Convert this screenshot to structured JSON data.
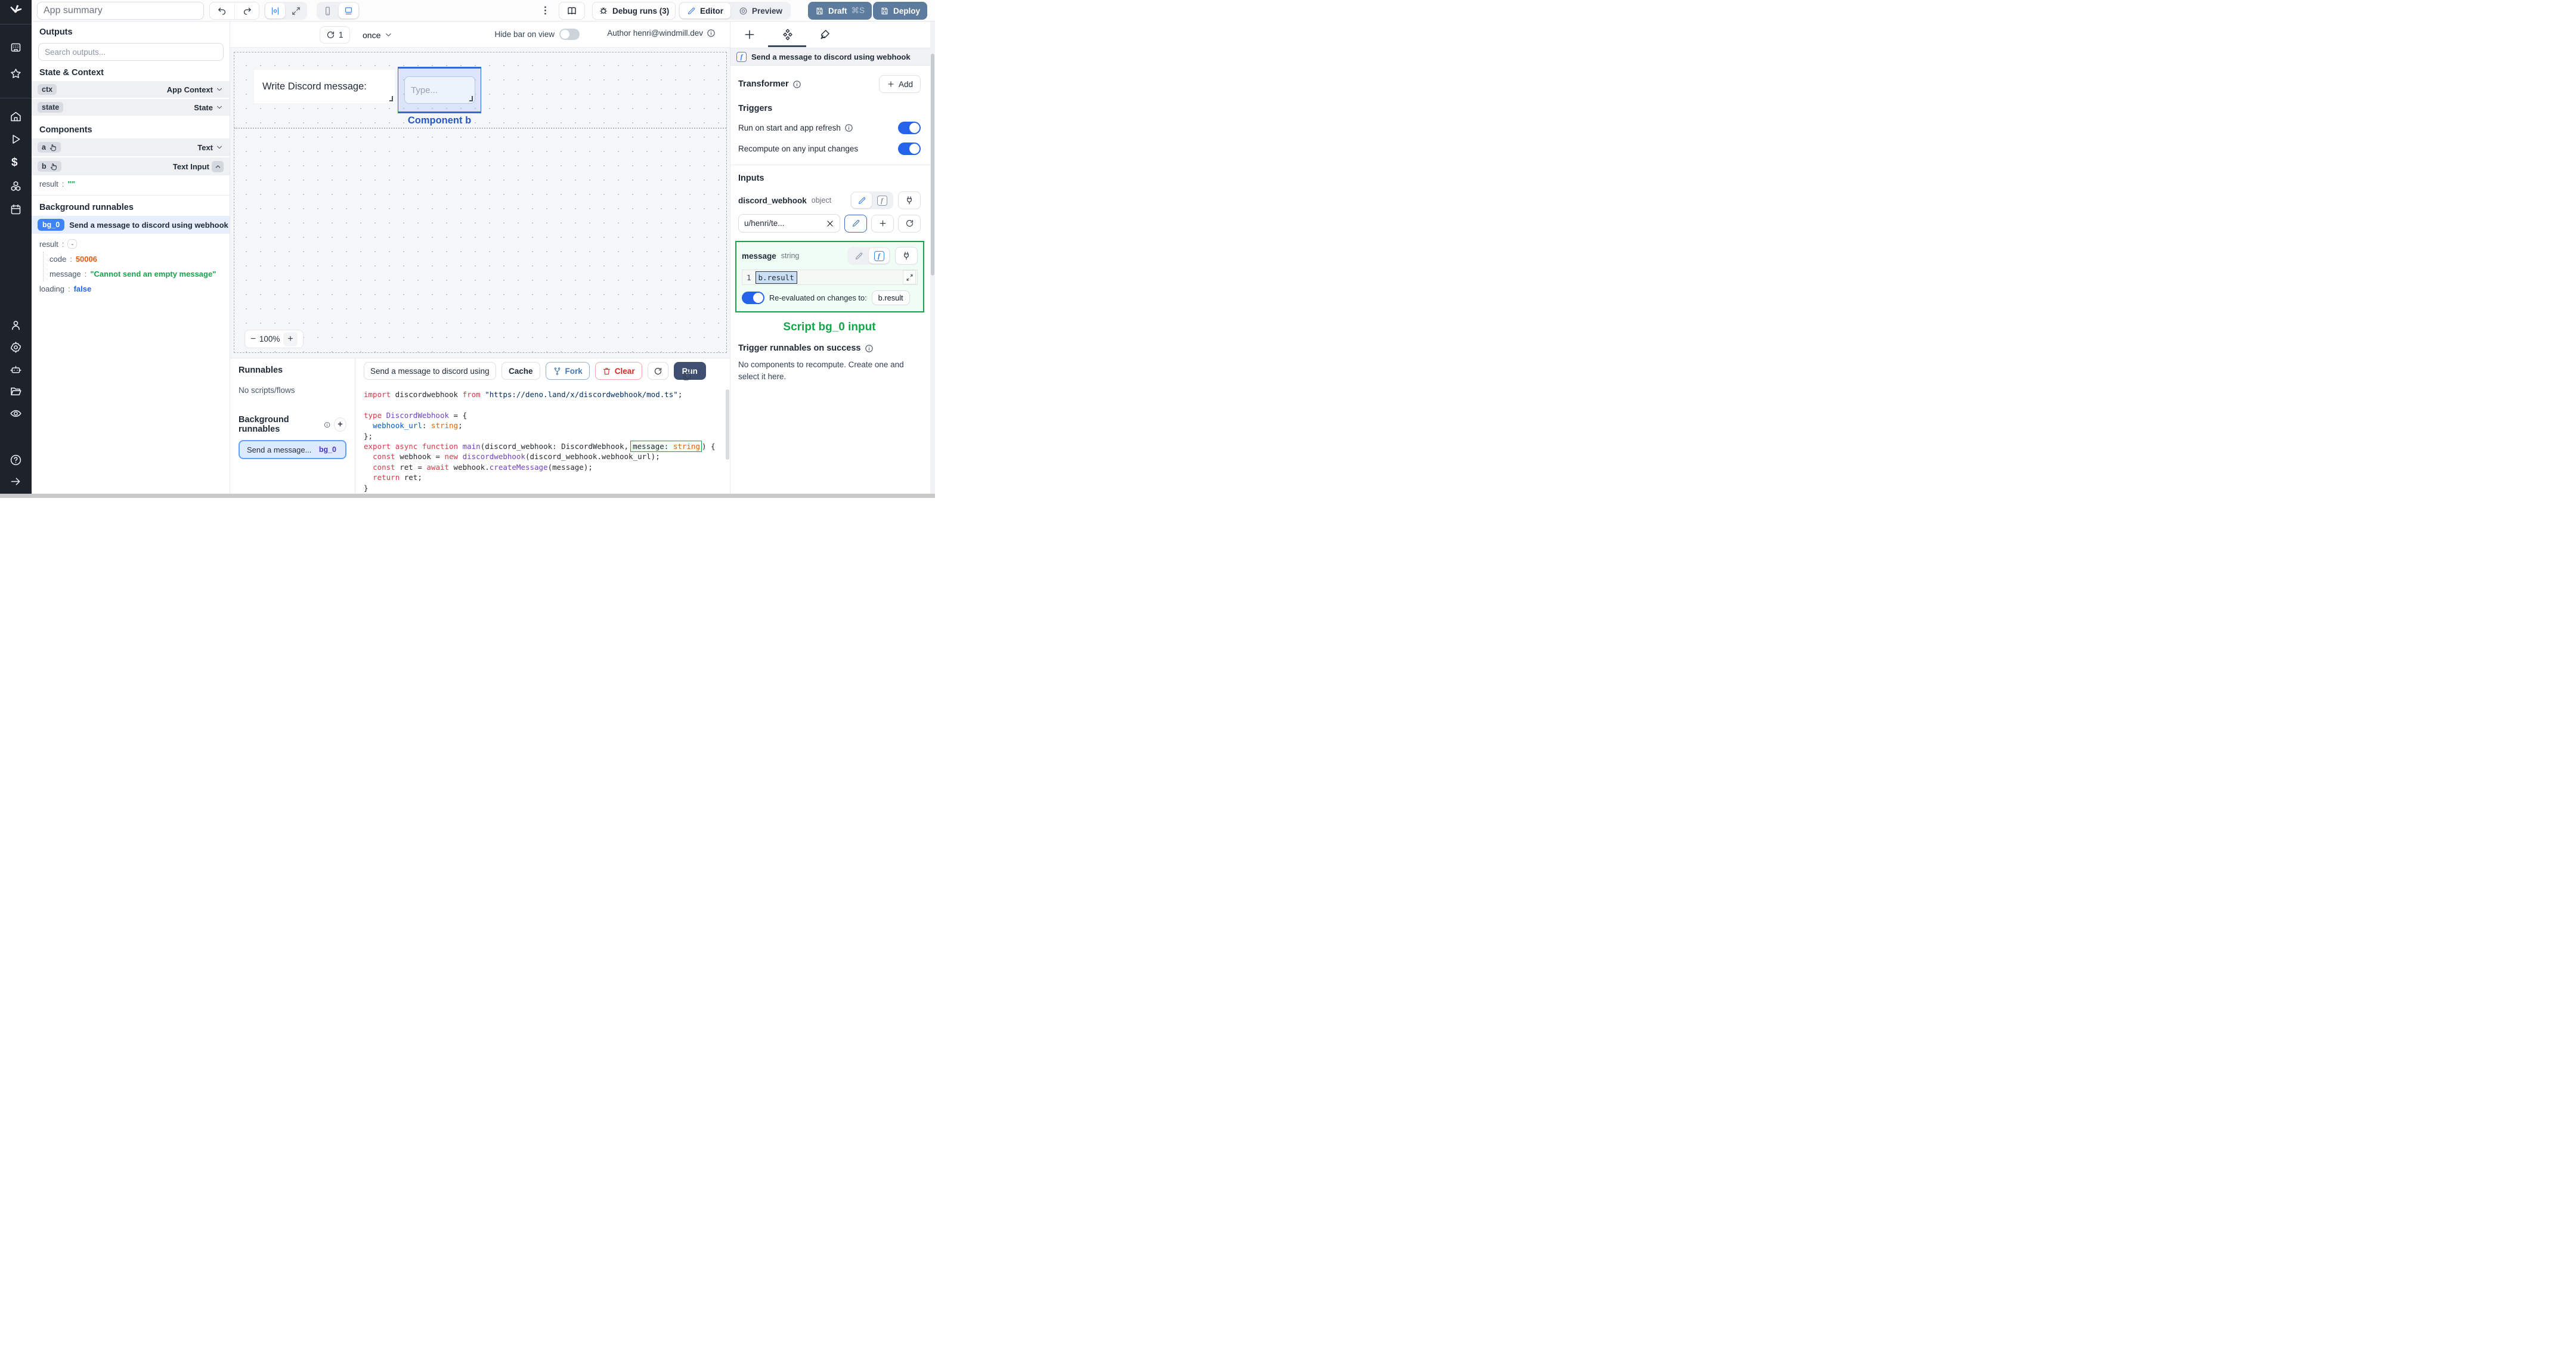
{
  "topbar": {
    "app_summary_placeholder": "App summary",
    "debug_runs_label": "Debug runs (3)",
    "editor_label": "Editor",
    "preview_label": "Preview",
    "draft_label": "Draft",
    "draft_shortcut": "⌘S",
    "deploy_label": "Deploy"
  },
  "left_panel": {
    "outputs_title": "Outputs",
    "search_placeholder": "Search outputs...",
    "state_context_title": "State & Context",
    "ctx": {
      "key": "ctx",
      "type": "App Context"
    },
    "state": {
      "key": "state",
      "type": "State"
    },
    "components_title": "Components",
    "comp_a": {
      "key": "a",
      "type": "Text"
    },
    "comp_b": {
      "key": "b",
      "type": "Text Input",
      "result_key": "result",
      "result_value": "\"\""
    },
    "bg_title": "Background runnables",
    "bg": {
      "badge": "bg_0",
      "name": "Send a message to discord using webhook",
      "result_key": "result",
      "collapse_glyph": "-",
      "code_key": "code",
      "code_value": "50006",
      "message_key": "message",
      "message_value": "\"Cannot send an empty message\"",
      "loading_key": "loading",
      "loading_value": "false"
    }
  },
  "canvas": {
    "refresh_count": "1",
    "mode": "once",
    "hide_bar_label": "Hide bar on view",
    "author_label": "Author henri@windmill.dev",
    "text_component": "Write Discord message:",
    "input_placeholder": "Type...",
    "selected_component_label": "Component b",
    "zoom_minus": "−",
    "zoom_value": "100%",
    "zoom_plus": "+"
  },
  "runnables": {
    "title": "Runnables",
    "empty_text": "No scripts/flows",
    "bg_title": "Background runnables",
    "add_glyph": "+",
    "item_name": "Send a message...",
    "item_badge": "bg_0"
  },
  "editor": {
    "name_value": "Send a message to discord using",
    "cache_label": "Cache",
    "fork_label": "Fork",
    "clear_label": "Clear",
    "run_label": "Run",
    "code_lines": [
      [
        [
          "kw",
          "import"
        ],
        [
          "pl",
          " discordwebhook "
        ],
        [
          "kw",
          "from"
        ],
        [
          "pl",
          " "
        ],
        [
          "str",
          "\"https://deno.land/x/discordwebhook/mod.ts\""
        ],
        [
          "pl",
          ";"
        ]
      ],
      [],
      [
        [
          "kw",
          "type"
        ],
        [
          "pl",
          " "
        ],
        [
          "ty",
          "DiscordWebhook"
        ],
        [
          "pl",
          " = {"
        ]
      ],
      [
        [
          "pl",
          "  "
        ],
        [
          "pr",
          "webhook_url"
        ],
        [
          "pl",
          ": "
        ],
        [
          "ot",
          "string"
        ],
        [
          "pl",
          ";"
        ]
      ],
      [
        [
          "pl",
          "};"
        ]
      ],
      [
        [
          "kw",
          "export"
        ],
        [
          "pl",
          " "
        ],
        [
          "kw",
          "async"
        ],
        [
          "pl",
          " "
        ],
        [
          "kw",
          "function"
        ],
        [
          "pl",
          " "
        ],
        [
          "fn",
          "main"
        ],
        [
          "pl",
          "(discord_webhook: DiscordWebhook,"
        ],
        [
          "bxl",
          "message: "
        ],
        [
          "bxr",
          "string"
        ],
        [
          "pl",
          ") {"
        ]
      ],
      [
        [
          "pl",
          "  "
        ],
        [
          "kw",
          "const"
        ],
        [
          "pl",
          " webhook = "
        ],
        [
          "kw",
          "new"
        ],
        [
          "pl",
          " "
        ],
        [
          "fn",
          "discordwebhook"
        ],
        [
          "pl",
          "(discord_webhook.webhook_url);"
        ]
      ],
      [
        [
          "pl",
          "  "
        ],
        [
          "kw",
          "const"
        ],
        [
          "pl",
          " ret = "
        ],
        [
          "kw",
          "await"
        ],
        [
          "pl",
          " webhook."
        ],
        [
          "fn",
          "createMessage"
        ],
        [
          "pl",
          "(message);"
        ]
      ],
      [
        [
          "pl",
          "  "
        ],
        [
          "kw",
          "return"
        ],
        [
          "pl",
          " ret;"
        ]
      ],
      [
        [
          "pl",
          "}"
        ]
      ]
    ]
  },
  "right_panel": {
    "header_title": "Send a message to discord using webhook",
    "transformer_label": "Transformer",
    "add_label": "Add",
    "triggers_title": "Triggers",
    "trigger_run_on_start": "Run on start and app refresh",
    "trigger_recompute": "Recompute on any input changes",
    "inputs_title": "Inputs",
    "discord_webhook": {
      "name": "discord_webhook",
      "type": "object",
      "value": "u/henri/te..."
    },
    "message": {
      "name": "message",
      "type": "string",
      "line_no": "1",
      "expr": "b.result"
    },
    "reeval_label": "Re-evaluated on changes to:",
    "reeval_target": "b.result",
    "script_input_label": "Script bg_0 input",
    "trigger_on_success_title": "Trigger runnables on success",
    "no_components_text": "No components to recompute. Create one and select it here."
  },
  "colors": {
    "accent_blue": "#3b82f6",
    "selection_blue": "#2f6bd8",
    "slate_button": "#5d7b9c",
    "run_button": "#3e4f71",
    "success_green": "#16a34a",
    "error_red": "#dc2626",
    "value_orange": "#ea580c",
    "value_green": "#16a34a",
    "value_blue": "#2563eb",
    "rail_dark": "#1e222b"
  }
}
